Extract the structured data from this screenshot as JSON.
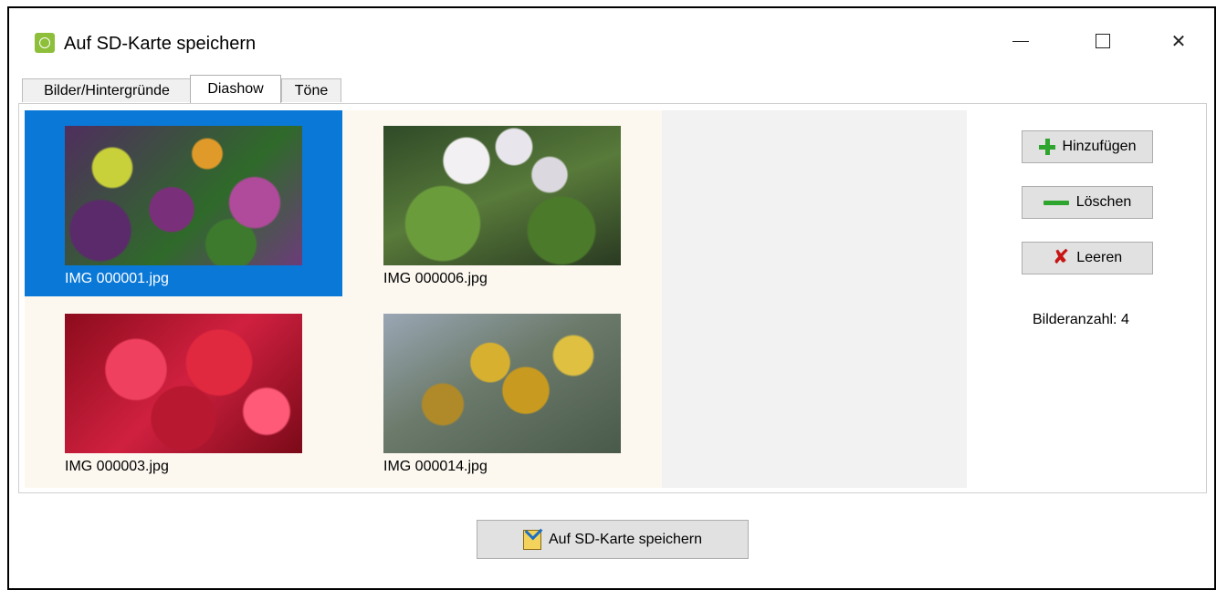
{
  "window": {
    "title": "Auf SD-Karte speichern",
    "icon": "app-icon",
    "controls": [
      "minimize-icon",
      "maximize-icon",
      "close-icon"
    ]
  },
  "tabs": [
    {
      "label": "Bilder/Hintergründe",
      "active": false
    },
    {
      "label": "Diashow",
      "active": true
    },
    {
      "label": "Töne",
      "active": false
    }
  ],
  "gallery": {
    "items": [
      {
        "filename": "IMG 000001.jpg",
        "selected": true
      },
      {
        "filename": "IMG 000006.jpg",
        "selected": false
      },
      {
        "filename": "IMG 000003.jpg",
        "selected": false
      },
      {
        "filename": "IMG 000014.jpg",
        "selected": false
      }
    ]
  },
  "side": {
    "add_label": "Hinzufügen",
    "delete_label": "Löschen",
    "clear_label": "Leeren",
    "count_text": "Bilderanzahl: 4"
  },
  "footer": {
    "save_label": "Auf SD-Karte speichern"
  },
  "colors": {
    "selection": "#0a78d7",
    "add_icon": "#2ea52e",
    "clear_icon": "#c81414"
  }
}
